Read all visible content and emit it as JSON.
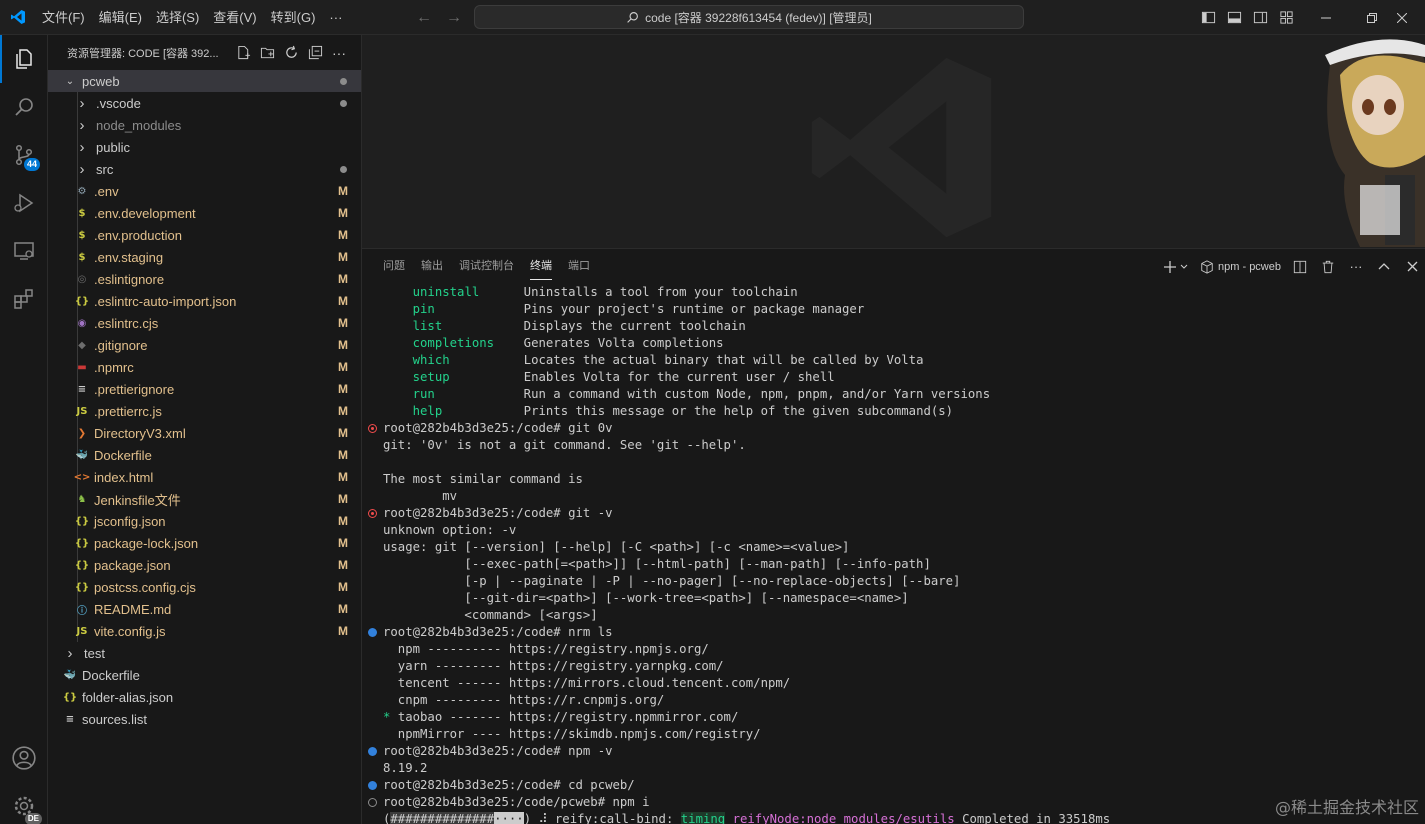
{
  "titlebar": {
    "menus": [
      "文件(F)",
      "编辑(E)",
      "选择(S)",
      "查看(V)",
      "转到(G)",
      "···"
    ],
    "command_center": "code [容器 39228f613454 (fedev)] [管理员]"
  },
  "activity": {
    "scm_badge": "44",
    "account_badge": "DE"
  },
  "sidebar": {
    "title": "资源管理器: CODE [容器 392...",
    "root": "pcweb",
    "items": [
      {
        "label": "vscode",
        "kind": "folder",
        "status": "dot",
        "icon": "chevron"
      },
      {
        "label": "node_modules",
        "kind": "folder",
        "status": "",
        "icon": "chevron"
      },
      {
        "label": "public",
        "kind": "folder",
        "status": "",
        "icon": "chevron"
      },
      {
        "label": "src",
        "kind": "folder",
        "status": "dot",
        "icon": "chevron"
      },
      {
        "label": ".env",
        "kind": "file",
        "status": "M",
        "icon": "gear"
      },
      {
        "label": ".env.development",
        "kind": "file",
        "status": "M",
        "icon": "dollar"
      },
      {
        "label": ".env.production",
        "kind": "file",
        "status": "M",
        "icon": "dollar"
      },
      {
        "label": ".env.staging",
        "kind": "file",
        "status": "M",
        "icon": "dollar"
      },
      {
        "label": ".eslintignore",
        "kind": "file",
        "status": "M",
        "icon": "circle"
      },
      {
        "label": ".eslintrc-auto-import.json",
        "kind": "file",
        "status": "M",
        "icon": "braces"
      },
      {
        "label": ".eslintrc.cjs",
        "kind": "file",
        "status": "M",
        "icon": "eslint"
      },
      {
        "label": ".gitignore",
        "kind": "file",
        "status": "M",
        "icon": "git"
      },
      {
        "label": ".npmrc",
        "kind": "file",
        "status": "M",
        "icon": "npm"
      },
      {
        "label": ".prettierignore",
        "kind": "file",
        "status": "M",
        "icon": "lines"
      },
      {
        "label": ".prettierrc.js",
        "kind": "file",
        "status": "M",
        "icon": "js"
      },
      {
        "label": "DirectoryV3.xml",
        "kind": "file",
        "status": "M",
        "icon": "rss"
      },
      {
        "label": "Dockerfile",
        "kind": "file",
        "status": "M",
        "icon": "docker"
      },
      {
        "label": "index.html",
        "kind": "file",
        "status": "M",
        "icon": "html"
      },
      {
        "label": "Jenkinsfile文件",
        "kind": "file",
        "status": "M",
        "icon": "jenkins"
      },
      {
        "label": "jsconfig.json",
        "kind": "file",
        "status": "M",
        "icon": "braces"
      },
      {
        "label": "package-lock.json",
        "kind": "file",
        "status": "M",
        "icon": "braces"
      },
      {
        "label": "package.json",
        "kind": "file",
        "status": "M",
        "icon": "braces"
      },
      {
        "label": "postcss.config.cjs",
        "kind": "file",
        "status": "M",
        "icon": "braces"
      },
      {
        "label": "README.md",
        "kind": "file",
        "status": "M",
        "icon": "info"
      },
      {
        "label": "vite.config.js",
        "kind": "file",
        "status": "M",
        "icon": "js"
      }
    ],
    "top_items": [
      {
        "label": "test",
        "kind": "folder",
        "icon": "chevron"
      },
      {
        "label": "Dockerfile",
        "kind": "file",
        "icon": "docker"
      },
      {
        "label": "folder-alias.json",
        "kind": "file",
        "icon": "braces"
      },
      {
        "label": "sources.list",
        "kind": "file",
        "icon": "lines"
      }
    ]
  },
  "panel": {
    "tabs": [
      "问题",
      "输出",
      "调试控制台",
      "终端",
      "端口"
    ],
    "active_tab": "终端",
    "terminal_name": "npm - pcweb"
  },
  "terminal": {
    "lines": [
      {
        "m": "",
        "segs": [
          [
            "    ",
            ""
          ],
          [
            "uninstall",
            "g"
          ],
          [
            "      Uninstalls a tool from your toolchain",
            ""
          ]
        ]
      },
      {
        "m": "",
        "segs": [
          [
            "    ",
            ""
          ],
          [
            "pin",
            "g"
          ],
          [
            "            Pins your project's runtime or package manager",
            ""
          ]
        ]
      },
      {
        "m": "",
        "segs": [
          [
            "    ",
            ""
          ],
          [
            "list",
            "g"
          ],
          [
            "           Displays the current toolchain",
            ""
          ]
        ]
      },
      {
        "m": "",
        "segs": [
          [
            "    ",
            ""
          ],
          [
            "completions",
            "g"
          ],
          [
            "    Generates Volta completions",
            ""
          ]
        ]
      },
      {
        "m": "",
        "segs": [
          [
            "    ",
            ""
          ],
          [
            "which",
            "g"
          ],
          [
            "          Locates the actual binary that will be called by Volta",
            ""
          ]
        ]
      },
      {
        "m": "",
        "segs": [
          [
            "    ",
            ""
          ],
          [
            "setup",
            "g"
          ],
          [
            "          Enables Volta for the current user / shell",
            ""
          ]
        ]
      },
      {
        "m": "",
        "segs": [
          [
            "    ",
            ""
          ],
          [
            "run",
            "g"
          ],
          [
            "            Run a command with custom Node, npm, pnpm, and/or Yarn versions",
            ""
          ]
        ]
      },
      {
        "m": "",
        "segs": [
          [
            "    ",
            ""
          ],
          [
            "help",
            "g"
          ],
          [
            "           Prints this message or the help of the given subcommand(s)",
            ""
          ]
        ]
      },
      {
        "m": "err",
        "segs": [
          [
            "root@282b4b3d3e25:/code# git 0v",
            ""
          ]
        ]
      },
      {
        "m": "",
        "segs": [
          [
            "git: '0v' is not a git command. See 'git --help'.",
            ""
          ]
        ]
      },
      {
        "m": "",
        "segs": [
          [
            "",
            ""
          ]
        ]
      },
      {
        "m": "",
        "segs": [
          [
            "The most similar command is",
            ""
          ]
        ]
      },
      {
        "m": "",
        "segs": [
          [
            "        mv",
            ""
          ]
        ]
      },
      {
        "m": "err",
        "segs": [
          [
            "root@282b4b3d3e25:/code# git -v",
            ""
          ]
        ]
      },
      {
        "m": "",
        "segs": [
          [
            "unknown option: -v",
            ""
          ]
        ]
      },
      {
        "m": "",
        "segs": [
          [
            "usage: git [--version] [--help] [-C <path>] [-c <name>=<value>]",
            ""
          ]
        ]
      },
      {
        "m": "",
        "segs": [
          [
            "           [--exec-path[=<path>]] [--html-path] [--man-path] [--info-path]",
            ""
          ]
        ]
      },
      {
        "m": "",
        "segs": [
          [
            "           [-p | --paginate | -P | --no-pager] [--no-replace-objects] [--bare]",
            ""
          ]
        ]
      },
      {
        "m": "",
        "segs": [
          [
            "           [--git-dir=<path>] [--work-tree=<path>] [--namespace=<name>]",
            ""
          ]
        ]
      },
      {
        "m": "",
        "segs": [
          [
            "           <command> [<args>]",
            ""
          ]
        ]
      },
      {
        "m": "ok",
        "segs": [
          [
            "root@282b4b3d3e25:/code# nrm ls",
            ""
          ]
        ]
      },
      {
        "m": "",
        "segs": [
          [
            "  npm ---------- https://registry.npmjs.org/",
            ""
          ]
        ]
      },
      {
        "m": "",
        "segs": [
          [
            "  yarn --------- https://registry.yarnpkg.com/",
            ""
          ]
        ]
      },
      {
        "m": "",
        "segs": [
          [
            "  tencent ------ https://mirrors.cloud.tencent.com/npm/",
            ""
          ]
        ]
      },
      {
        "m": "",
        "segs": [
          [
            "  cnpm --------- https://r.cnpmjs.org/",
            ""
          ]
        ]
      },
      {
        "m": "",
        "segs": [
          [
            "* ",
            "g"
          ],
          [
            "taobao ------- https://registry.npmmirror.com/",
            ""
          ]
        ]
      },
      {
        "m": "",
        "segs": [
          [
            "  npmMirror ---- https://skimdb.npmjs.com/registry/",
            ""
          ]
        ]
      },
      {
        "m": "ok",
        "segs": [
          [
            "root@282b4b3d3e25:/code# npm -v",
            ""
          ]
        ]
      },
      {
        "m": "",
        "segs": [
          [
            "8.19.2",
            ""
          ]
        ]
      },
      {
        "m": "ok",
        "segs": [
          [
            "root@282b4b3d3e25:/code# cd pcweb/",
            ""
          ]
        ]
      },
      {
        "m": "pending",
        "segs": [
          [
            "root@282b4b3d3e25:/code/pcweb# npm i",
            ""
          ]
        ]
      },
      {
        "m": "",
        "segs": [
          [
            "(",
            ""
          ],
          [
            "##############",
            "p"
          ],
          [
            "····",
            "h"
          ],
          [
            ") ⠼ reify:call-bind: ",
            ""
          ],
          [
            "timing",
            "gb"
          ],
          [
            " ",
            ""
          ],
          [
            "reifyNode:node_modules/esutils",
            "m"
          ],
          [
            " Completed in 33518ms",
            ""
          ]
        ]
      }
    ]
  },
  "watermark": "@稀土掘金技术社区",
  "colors": {
    "accent": "#0078d4",
    "modified": "#e2c08d",
    "term_green": "#23d18b",
    "term_magenta": "#d670d6"
  }
}
